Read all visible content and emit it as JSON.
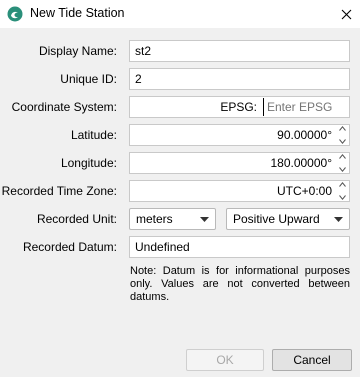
{
  "window": {
    "title": "New Tide Station"
  },
  "form": {
    "display_name": {
      "label": "Display Name:",
      "value": "st2"
    },
    "unique_id": {
      "label": "Unique ID:",
      "value": "2"
    },
    "coordinate_system": {
      "label": "Coordinate System:",
      "prefix": "EPSG:",
      "placeholder": "Enter EPSG"
    },
    "latitude": {
      "label": "Latitude:",
      "value": "90.00000°"
    },
    "longitude": {
      "label": "Longitude:",
      "value": "180.00000°"
    },
    "time_zone": {
      "label": "Recorded Time Zone:",
      "value": "UTC+0:00"
    },
    "recorded_unit": {
      "label": "Recorded Unit:",
      "unit": "meters",
      "direction": "Positive Upward"
    },
    "recorded_datum": {
      "label": "Recorded Datum:",
      "value": "Undefined"
    },
    "note": "Note: Datum is for informational purposes only. Values are not converted between datums."
  },
  "buttons": {
    "ok": "OK",
    "cancel": "Cancel"
  },
  "icons": {
    "app": "tide-app-icon",
    "close": "close-icon"
  },
  "colors": {
    "app_icon": "#2a8f7a",
    "disabled_text": "#a8a8a8",
    "background": "#f0f0f0"
  }
}
